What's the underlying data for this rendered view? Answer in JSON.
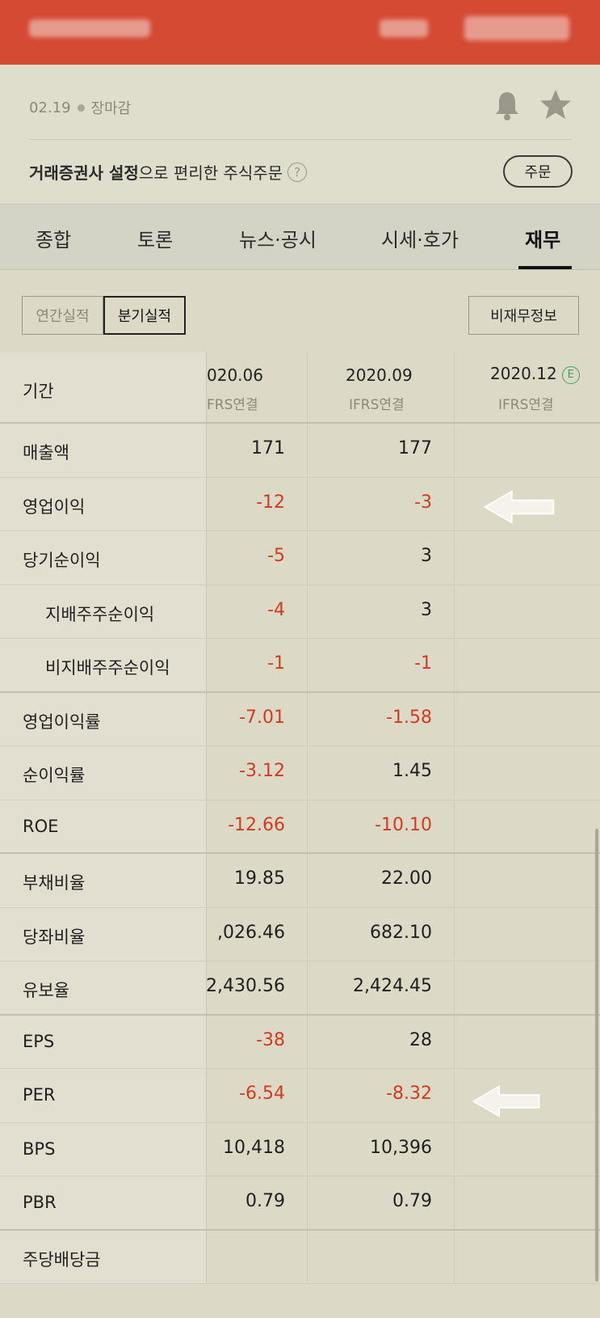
{
  "header": {
    "date": "02.19",
    "status": "장마감",
    "broker_strong": "거래증권사 설정",
    "broker_rest": "으로 편리한 주식주문",
    "help": "?",
    "order_label": "주문"
  },
  "tabs": [
    {
      "label": "종합"
    },
    {
      "label": "토론"
    },
    {
      "label": "뉴스·공시"
    },
    {
      "label": "시세·호가"
    },
    {
      "label": "재무"
    }
  ],
  "toggles": {
    "annual": "연간실적",
    "quarterly": "분기실적",
    "nonfinancial": "비재무정보"
  },
  "table": {
    "period_label": "기간",
    "columns": [
      {
        "date": "020.06",
        "sub": "FRS연결"
      },
      {
        "date": "2020.09",
        "sub": "IFRS연결"
      },
      {
        "date": "2020.12",
        "sub": "IFRS연결",
        "badge": "E"
      }
    ],
    "rows": [
      {
        "label": "매출액",
        "v1": "171",
        "v2": "177"
      },
      {
        "label": "영업이익",
        "v1": "-12",
        "v2": "-3"
      },
      {
        "label": "당기순이익",
        "v1": "-5",
        "v2": "3"
      },
      {
        "label": "지배주주순이익",
        "v1": "-4",
        "v2": "3"
      },
      {
        "label": "비지배주주순이익",
        "v1": "-1",
        "v2": "-1"
      },
      {
        "label": "영업이익률",
        "v1": "-7.01",
        "v2": "-1.58"
      },
      {
        "label": "순이익률",
        "v1": "-3.12",
        "v2": "1.45"
      },
      {
        "label": "ROE",
        "v1": "-12.66",
        "v2": "-10.10"
      },
      {
        "label": "부채비율",
        "v1": "19.85",
        "v2": "22.00"
      },
      {
        "label": "당좌비율",
        "v1": ",026.46",
        "v2": "682.10"
      },
      {
        "label": "유보율",
        "v1": "2,430.56",
        "v2": "2,424.45"
      },
      {
        "label": "EPS",
        "v1": "-38",
        "v2": "28"
      },
      {
        "label": "PER",
        "v1": "-6.54",
        "v2": "-8.32"
      },
      {
        "label": "BPS",
        "v1": "10,418",
        "v2": "10,396"
      },
      {
        "label": "PBR",
        "v1": "0.79",
        "v2": "0.79"
      },
      {
        "label": "주당배당금",
        "v1": "",
        "v2": ""
      }
    ]
  },
  "colors": {
    "brand_red": "#d44a33",
    "negative": "#d23a20",
    "estimate_green": "#3aa655"
  }
}
